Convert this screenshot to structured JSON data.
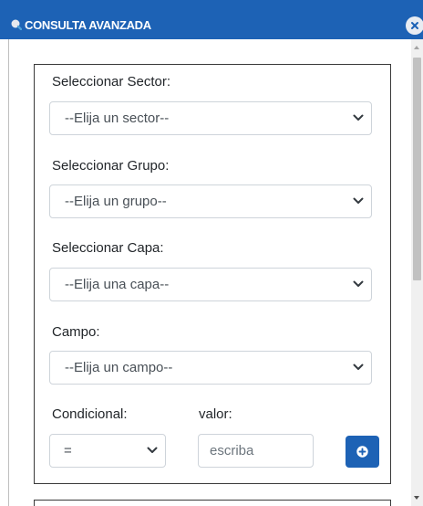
{
  "window": {
    "title": "CONSULTA AVANZADA",
    "accent_color": "#1d62b5"
  },
  "form": {
    "sector": {
      "label": "Seleccionar Sector:",
      "selected": "--Elija un sector--"
    },
    "grupo": {
      "label": "Seleccionar Grupo:",
      "selected": "--Elija un grupo--"
    },
    "capa": {
      "label": "Seleccionar Capa:",
      "selected": "--Elija una capa--"
    },
    "campo": {
      "label": "Campo:",
      "selected": "--Elija un campo--"
    },
    "condicional": {
      "label": "Condicional:",
      "selected": "="
    },
    "valor": {
      "label": "valor:",
      "placeholder": "escriba",
      "value": ""
    }
  },
  "icons": {
    "title": "search-icon",
    "close": "close-icon",
    "add": "plus-circle-icon",
    "dropdown": "chevron-down-icon"
  }
}
